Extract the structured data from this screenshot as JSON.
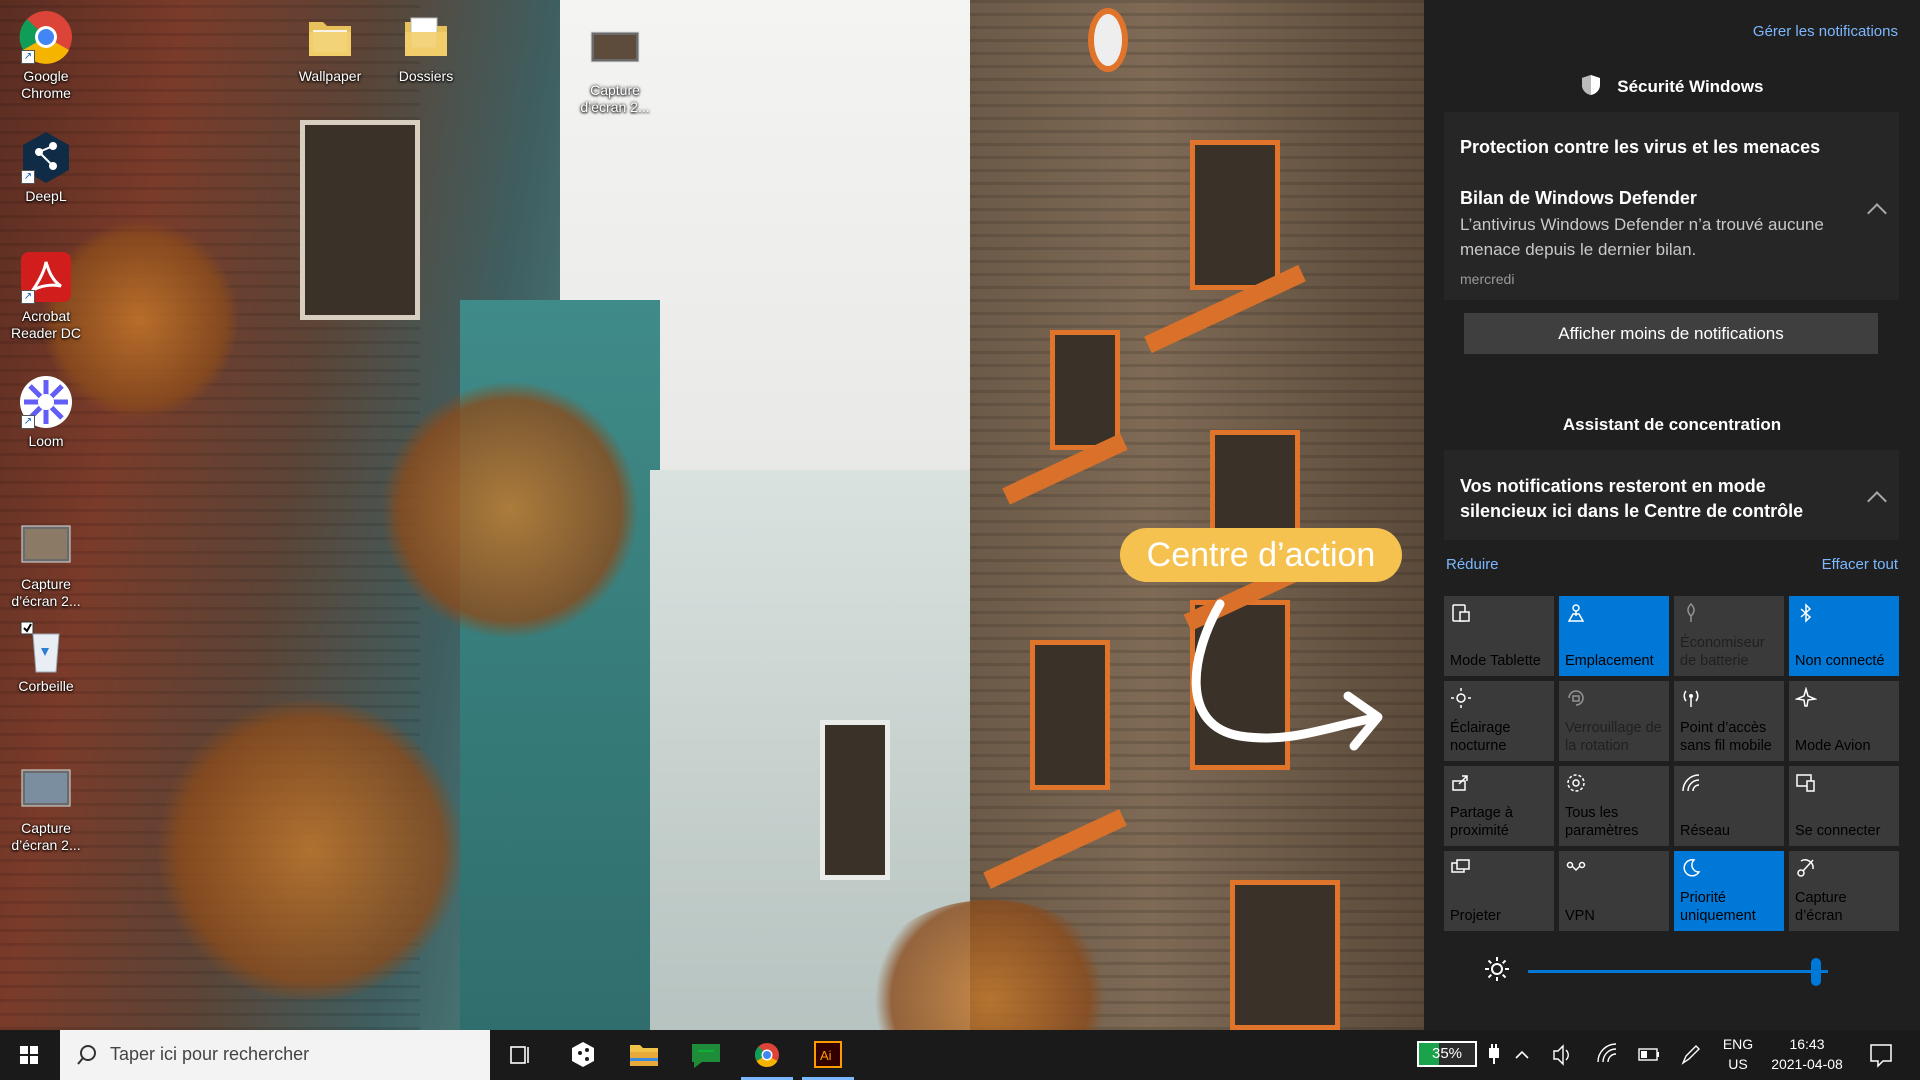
{
  "desktop": {
    "icons": [
      {
        "label": "Google Chrome",
        "icon": "chrome-icon"
      },
      {
        "label": "DeepL",
        "icon": "deepl-icon"
      },
      {
        "label": "Acrobat Reader DC",
        "icon": "acrobat-icon"
      },
      {
        "label": "Loom",
        "icon": "loom-icon"
      },
      {
        "label": "Capture d’écran 2...",
        "icon": "screenshot-file-icon"
      },
      {
        "label": "Corbeille",
        "icon": "recycle-bin-icon"
      },
      {
        "label": "Capture d’écran 2...",
        "icon": "screenshot-file-icon"
      },
      {
        "label": "Wallpaper",
        "icon": "folder-icon"
      },
      {
        "label": "Dossiers",
        "icon": "folder-icon"
      },
      {
        "label": "Capture d’écran 2...",
        "icon": "screenshot-file-icon"
      }
    ]
  },
  "annotation": {
    "text": "Centre d’action"
  },
  "action_center": {
    "manage_link": "Gérer les notifications",
    "security_group_title": "Sécurité Windows",
    "notification": {
      "heading": "Protection contre les virus et les menaces",
      "title": "Bilan de Windows Defender",
      "body": "L’antivirus Windows Defender n’a trouvé aucune menace depuis le dernier bilan.",
      "time": "mercredi"
    },
    "show_less_button": "Afficher moins de notifications",
    "focus_group_title": "Assistant de concentration",
    "focus_message": "Vos notifications resteront en mode silencieux ici dans le Centre de contrôle",
    "collapse_link": "Réduire",
    "clear_all_link": "Effacer tout",
    "tiles": [
      {
        "label": "Mode Tablette",
        "icon": "tablet-mode-icon",
        "state": "off"
      },
      {
        "label": "Emplacement",
        "icon": "location-icon",
        "state": "on"
      },
      {
        "label": "Économiseur de batterie",
        "icon": "battery-saver-icon",
        "state": "disabled"
      },
      {
        "label": "Non connecté",
        "icon": "bluetooth-icon",
        "state": "on"
      },
      {
        "label": "Éclairage nocturne",
        "icon": "night-light-icon",
        "state": "off"
      },
      {
        "label": "Verrouillage de la rotation",
        "icon": "rotation-lock-icon",
        "state": "disabled"
      },
      {
        "label": "Point d’accès sans fil mobile",
        "icon": "hotspot-icon",
        "state": "off"
      },
      {
        "label": "Mode Avion",
        "icon": "airplane-icon",
        "state": "off"
      },
      {
        "label": "Partage à proximité",
        "icon": "nearby-share-icon",
        "state": "off"
      },
      {
        "label": "Tous les paramètres",
        "icon": "settings-gear-icon",
        "state": "off"
      },
      {
        "label": "Réseau",
        "icon": "network-icon",
        "state": "off"
      },
      {
        "label": "Se connecter",
        "icon": "connect-icon",
        "state": "off"
      },
      {
        "label": "Projeter",
        "icon": "project-icon",
        "state": "off"
      },
      {
        "label": "VPN",
        "icon": "vpn-icon",
        "state": "off"
      },
      {
        "label": "Priorité uniquement",
        "icon": "moon-icon",
        "state": "on"
      },
      {
        "label": "Capture d’écran",
        "icon": "snip-icon",
        "state": "off"
      }
    ],
    "brightness_level": 0.96
  },
  "taskbar": {
    "search_placeholder": "Taper ici pour rechercher",
    "apps": [
      "task-view-icon",
      "deepl-icon",
      "file-explorer-icon",
      "chat-icon",
      "chrome-icon",
      "illustrator-icon"
    ],
    "battery_percent": "35%",
    "battery_level": 0.35,
    "language": "ENG",
    "region": "US",
    "time": "16:43",
    "date": "2021-04-08"
  },
  "colors": {
    "accent": "#0078d7",
    "panel_bg": "#1f1f1f",
    "tile_bg": "#3a3a3a",
    "link": "#7cb8ff",
    "annotation": "#f6c24f"
  }
}
